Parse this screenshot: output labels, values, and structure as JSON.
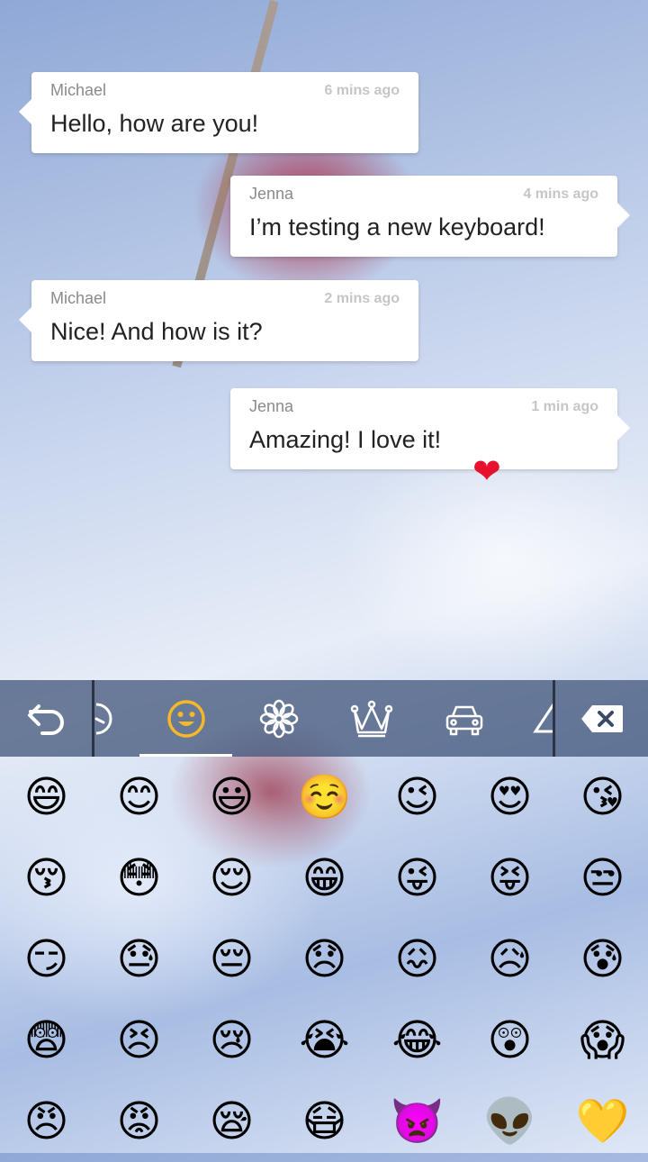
{
  "messages": [
    {
      "sender": "Michael",
      "time": "6 mins ago",
      "text": "Hello, how are you!"
    },
    {
      "sender": "Jenna",
      "time": "4 mins ago",
      "text": "I’m testing a new keyboard!"
    },
    {
      "sender": "Michael",
      "time": "2 mins ago",
      "text": "Nice! And how is it?"
    },
    {
      "sender": "Jenna",
      "time": "1 min ago",
      "text": "Amazing! I love it!",
      "emoji": "❤"
    }
  ],
  "toolbar": {
    "back_icon": "undo-arrow-icon",
    "recent_icon": "clock-icon",
    "tabs": [
      {
        "icon": "smiley-icon",
        "active": true
      },
      {
        "icon": "flower-icon",
        "active": false
      },
      {
        "icon": "crown-icon",
        "active": false
      },
      {
        "icon": "car-icon",
        "active": false
      },
      {
        "icon": "triangle-symbol-icon",
        "active": false
      }
    ],
    "delete_icon": "backspace-icon",
    "accent_color": "#f5b829"
  },
  "emoji_grid": [
    [
      "😄",
      "😊",
      "😃",
      "☺️",
      "😉",
      "😍",
      "😘"
    ],
    [
      "😚",
      "😳",
      "😌",
      "😁",
      "😜",
      "😝",
      "😒"
    ],
    [
      "😏",
      "😓",
      "😔",
      "😞",
      "😖",
      "😥",
      "😰"
    ],
    [
      "😨",
      "😣",
      "😢",
      "😭",
      "😂",
      "😲",
      "😱"
    ],
    [
      "😠",
      "😡",
      "😪",
      "😷",
      "👿",
      "👽",
      "💛"
    ]
  ]
}
